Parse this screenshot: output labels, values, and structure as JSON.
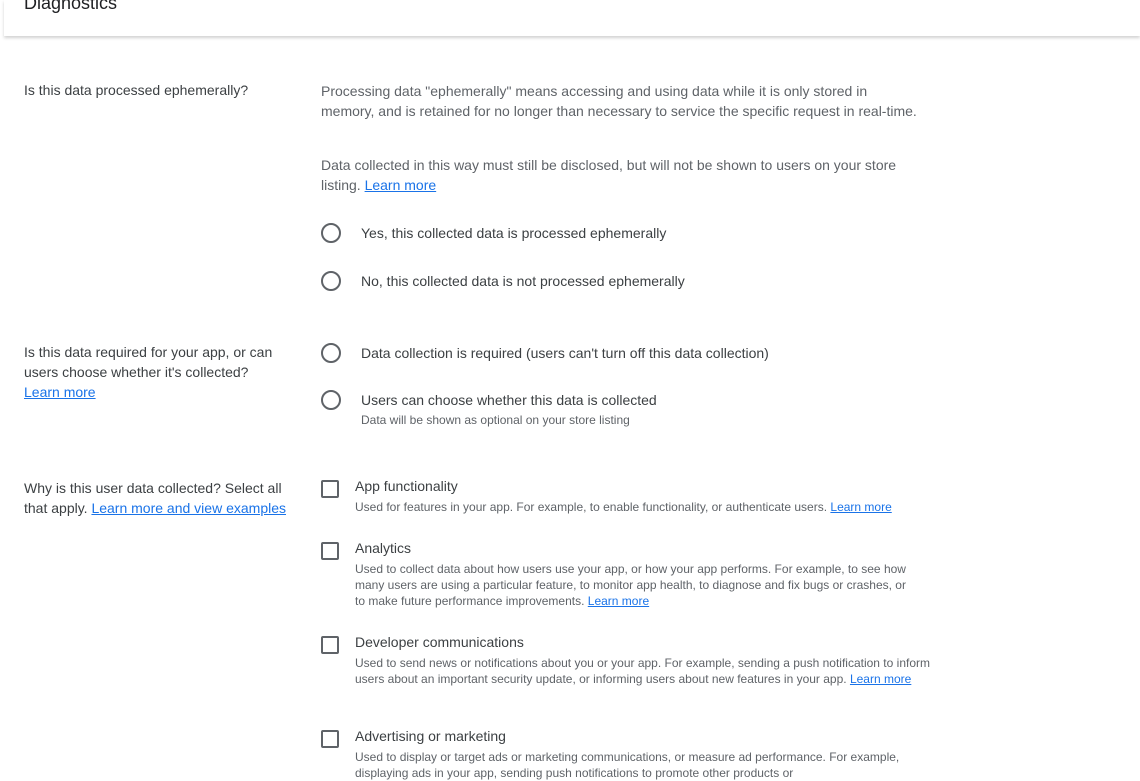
{
  "header": {
    "title": "Diagnostics"
  },
  "ephemeral": {
    "question": "Is this data processed ephemerally?",
    "desc1": "Processing data \"ephemerally\" means accessing and using data while it is only stored in memory, and is retained for no longer than necessary to service the specific request in real-time.",
    "desc2": "Data collected in this way must still be disclosed, but will not be shown to users on your store listing.",
    "learn_more": "Learn more",
    "options": [
      {
        "label": "Yes, this collected data is processed ephemerally"
      },
      {
        "label": "No, this collected data is not processed ephemerally"
      }
    ]
  },
  "required": {
    "question": "Is this data required for your app, or can users choose whether it's collected?",
    "learn_more": "Learn more",
    "options": [
      {
        "label": "Data collection is required (users can't turn off this data collection)"
      },
      {
        "label": "Users can choose whether this data is collected",
        "sub": "Data will be shown as optional on your store listing"
      }
    ]
  },
  "purpose": {
    "question": "Why is this user data collected? Select all that apply.",
    "learn_more": "Learn more and view examples",
    "options": [
      {
        "label": "App functionality",
        "desc": "Used for features in your app. For example, to enable functionality, or authenticate users.",
        "link": "Learn more"
      },
      {
        "label": "Analytics",
        "desc": "Used to collect data about how users use your app, or how your app performs. For example, to see how many users are using a particular feature, to monitor app health, to diagnose and fix bugs or crashes, or to make future performance improvements.",
        "link": "Learn more"
      },
      {
        "label": "Developer communications",
        "desc": "Used to send news or notifications about you or your app. For example, sending a push notification to inform users about an important security update, or informing users about new features in your app.",
        "link": "Learn more"
      },
      {
        "label": "Advertising or marketing",
        "desc": "Used to display or target ads or marketing communications, or measure ad performance. For example, displaying ads in your app, sending push notifications to promote other products or"
      }
    ]
  }
}
